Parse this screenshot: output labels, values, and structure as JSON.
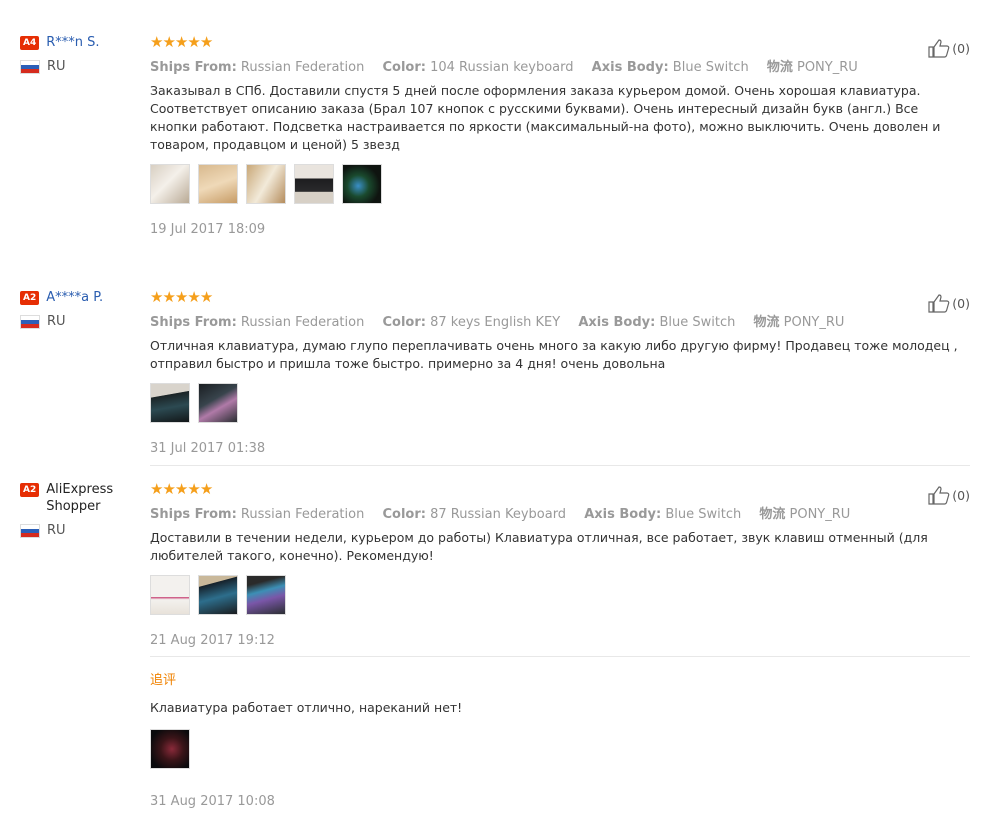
{
  "labels": {
    "ships_from": "Ships From:",
    "color": "Color:",
    "axis_body": "Axis Body:",
    "logistics": "物流",
    "followup": "追评"
  },
  "colors": {
    "badge": "#e62e04",
    "star": "#f59f1b",
    "link": "#2a5db0",
    "followup": "#f08200"
  },
  "reviews": [
    {
      "badge": "A4",
      "user": "R***n S.",
      "country": "RU",
      "rating": 5,
      "ships_from": "Russian Federation",
      "color": "104 Russian keyboard",
      "axis_body": "Blue Switch",
      "logistics": "PONY_RU",
      "text": "Заказывал в СПб. Доставили спустя 5 дней после оформления заказа курьером домой. Очень хорошая клавиатура. Соответствует описанию заказа (Брал 107 кнопок с русскими буквами). Очень интересный дизайн букв (англ.) Все кнопки работают. Подсветка настраивается по яркости (максимальный-на фото), можно выключить. Очень доволен и товаром, продавцом и ценой) 5 звезд",
      "images": [
        "photo-box-open",
        "photo-box",
        "photo-packaging",
        "photo-keyboard",
        "photo-keyboard-lit"
      ],
      "date": "19 Jul 2017 18:09",
      "likes": "(0)"
    },
    {
      "badge": "A2",
      "user": "A****a P.",
      "country": "RU",
      "rating": 5,
      "ships_from": "Russian Federation",
      "color": "87 keys English KEY",
      "axis_body": "Blue Switch",
      "logistics": "PONY_RU",
      "text": "Отличная клавиатура, думаю глупо переплачивать очень много за какую либо другую фирму! Продавец тоже молодец , отправил быстро и пришла тоже быстро. примерно за 4 дня! очень довольна",
      "images": [
        "photo-keyboard-desk",
        "photo-keyboard-mouse"
      ],
      "date": "31 Jul 2017 01:38",
      "likes": "(0)"
    },
    {
      "badge": "A2",
      "user": "AliExpress Shopper",
      "country": "RU",
      "rating": 5,
      "ships_from": "Russian Federation",
      "color": "87 Russian Keyboard",
      "axis_body": "Blue Switch",
      "logistics": "PONY_RU",
      "text": "Доставили в течении недели, курьером до работы) Клавиатура отличная, все работает, звук клавиш отменный (для любителей такого, конечно). Рекомендую!",
      "images": [
        "photo-box-label",
        "photo-keyboard-dark",
        "photo-keyboard-rgb"
      ],
      "date": "21 Aug 2017 19:12",
      "likes": "(0)",
      "followup": {
        "text": "Клавиатура работает отлично, нареканий нет!",
        "images": [
          "photo-keyboard-night"
        ],
        "date": "31 Aug 2017 10:08"
      }
    }
  ]
}
